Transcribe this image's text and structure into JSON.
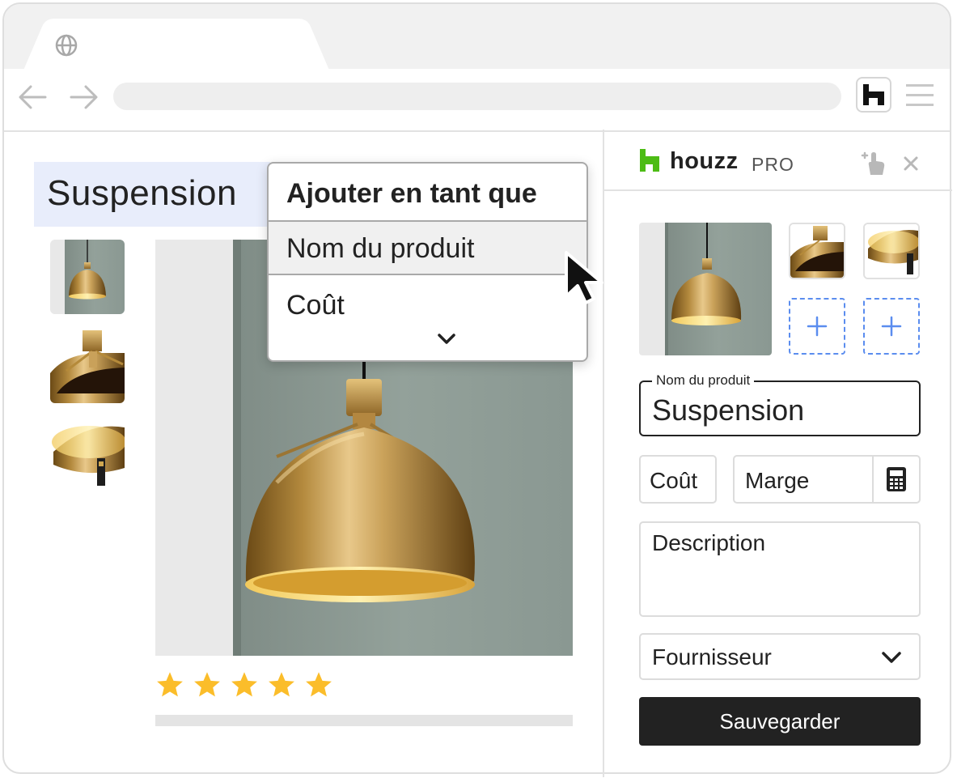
{
  "browser": {
    "tab_icon": "globe-icon",
    "extension_icon": "houzz-h-icon",
    "menu_icon": "hamburger-icon"
  },
  "page": {
    "product_title": "Suspension",
    "rating_stars": 5
  },
  "context_menu": {
    "header": "Ajouter en tant que",
    "items": [
      "Nom du produit",
      "Coût"
    ],
    "more_icon": "chevron-down-icon"
  },
  "panel": {
    "brand": "houzz",
    "brand_suffix": "PRO",
    "name_label": "Nom du produit",
    "name_value": "Suspension",
    "cost_placeholder": "Coût",
    "margin_placeholder": "Marge",
    "description_placeholder": "Description",
    "supplier_placeholder": "Fournisseur",
    "save_label": "Sauvegarder"
  },
  "colors": {
    "brand_green": "#4dbc15",
    "star_yellow": "#fbbd2a",
    "add_slot_blue": "#5b8def",
    "title_highlight": "#e8edfb",
    "save_button": "#222222"
  }
}
